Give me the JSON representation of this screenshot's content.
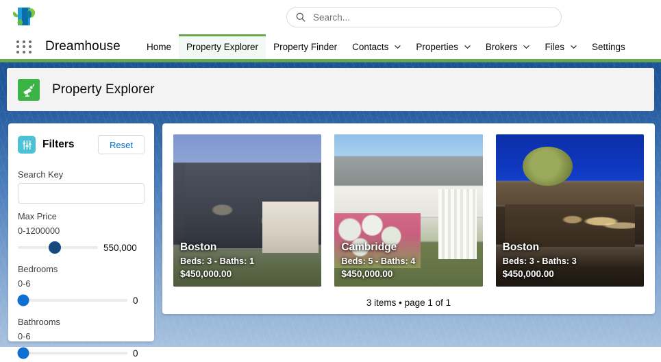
{
  "header": {
    "logo_icon": "dreamhouse-logo-icon",
    "search": {
      "icon": "search-icon",
      "placeholder": "Search...",
      "value": ""
    }
  },
  "nav": {
    "app_launcher_icon": "app-launcher-grid-icon",
    "app_name": "Dreamhouse",
    "items": [
      {
        "label": "Home",
        "active": false,
        "has_menu": false
      },
      {
        "label": "Property Explorer",
        "active": true,
        "has_menu": false
      },
      {
        "label": "Property Finder",
        "active": false,
        "has_menu": false
      },
      {
        "label": "Contacts",
        "active": false,
        "has_menu": true
      },
      {
        "label": "Properties",
        "active": false,
        "has_menu": true
      },
      {
        "label": "Brokers",
        "active": false,
        "has_menu": true
      },
      {
        "label": "Files",
        "active": false,
        "has_menu": true
      },
      {
        "label": "Settings",
        "active": false,
        "has_menu": false
      }
    ]
  },
  "page": {
    "icon": "telescope-icon",
    "icon_color": "#3bb345",
    "title": "Property Explorer"
  },
  "filters": {
    "icon": "filter-sliders-icon",
    "icon_color": "#4bc3d4",
    "title": "Filters",
    "reset_label": "Reset",
    "search_key": {
      "label": "Search Key",
      "value": "",
      "placeholder": ""
    },
    "sliders": [
      {
        "label": "Max Price",
        "range": "0-1200000",
        "min": 0,
        "max": 1200000,
        "value": 550000,
        "value_display": "550,000",
        "percent": 45.8,
        "thumb_color": "#14487f"
      },
      {
        "label": "Bedrooms",
        "range": "0-6",
        "min": 0,
        "max": 6,
        "value": 0,
        "value_display": "0",
        "percent": 0,
        "thumb_color": "#0d6fd1"
      },
      {
        "label": "Bathrooms",
        "range": "0-6",
        "min": 0,
        "max": 6,
        "value": 0,
        "value_display": "0",
        "percent": 0,
        "thumb_color": "#0d6fd1"
      }
    ]
  },
  "results": {
    "tiles": [
      {
        "city": "Boston",
        "beds_baths": "Beds: 3 - Baths: 1",
        "price": "$450,000.00",
        "image": "grey-craftsman-house-photo"
      },
      {
        "city": "Cambridge",
        "beds_baths": "Beds: 5 - Baths: 4",
        "price": "$450,000.00",
        "image": "white-porch-house-with-flowers-photo"
      },
      {
        "city": "Boston",
        "beds_baths": "Beds: 3 - Baths: 3",
        "price": "$450,000.00",
        "image": "modern-house-dusk-pool-photo"
      }
    ],
    "pagination": "3 items • page 1 of 1"
  }
}
